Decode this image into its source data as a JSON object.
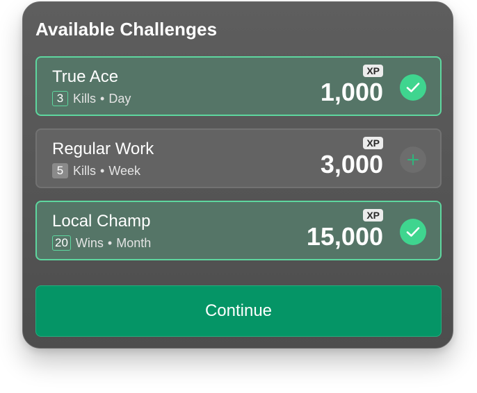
{
  "header": {
    "title": "Available Challenges"
  },
  "challenges": [
    {
      "name": "True Ace",
      "count": "3",
      "unit": "Kills",
      "separator": "•",
      "period": "Day",
      "xp_label": "XP",
      "xp": "1,000",
      "selected": true,
      "action_icon": "check-icon"
    },
    {
      "name": "Regular Work",
      "count": "5",
      "unit": "Kills",
      "separator": "•",
      "period": "Week",
      "xp_label": "XP",
      "xp": "3,000",
      "selected": false,
      "action_icon": "plus-icon"
    },
    {
      "name": "Local Champ",
      "count": "20",
      "unit": "Wins",
      "separator": "•",
      "period": "Month",
      "xp_label": "XP",
      "xp": "15,000",
      "selected": true,
      "action_icon": "check-icon"
    }
  ],
  "footer": {
    "continue_label": "Continue"
  },
  "colors": {
    "panel_background": "#555555",
    "selected_card_background": "#557567",
    "selected_border": "#5ed79f",
    "unselected_card_background": "#636363",
    "check_button": "#3fd58f",
    "add_button": "#6d6d6d",
    "plus_glyph": "#2fb57c",
    "primary_button": "#059566",
    "xp_tag_background": "#ececec"
  }
}
